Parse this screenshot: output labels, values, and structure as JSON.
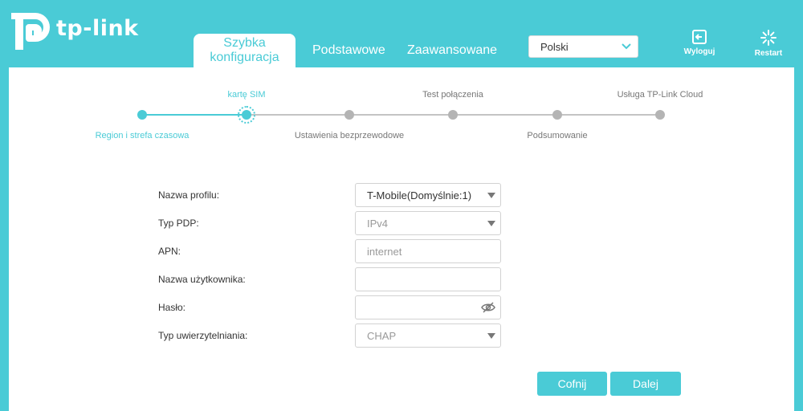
{
  "brand": {
    "name": "tp-link",
    "accent_color": "#4acbd6"
  },
  "nav": {
    "tabs": [
      {
        "label": "Szybka konfiguracja",
        "active": true
      },
      {
        "label": "Podstawowe",
        "active": false
      },
      {
        "label": "Zaawansowane",
        "active": false
      }
    ]
  },
  "language": {
    "selected": "Polski",
    "icon": "chevron-down-icon"
  },
  "header_buttons": {
    "logout": {
      "label": "Wyloguj",
      "icon": "logout-icon"
    },
    "restart": {
      "label": "Restart",
      "icon": "restart-icon"
    }
  },
  "stepper": {
    "current_index": 1,
    "steps": [
      {
        "label": "Region i strefa czasowa"
      },
      {
        "label": "kartę SIM"
      },
      {
        "label": "Ustawienia bezprzewodowe"
      },
      {
        "label": "Test połączenia"
      },
      {
        "label": "Podsumowanie"
      },
      {
        "label": "Usługa TP-Link Cloud"
      }
    ]
  },
  "form": {
    "profile": {
      "label": "Nazwa profilu:",
      "value": "T-Mobile(Domyślnie:1)"
    },
    "pdp_type": {
      "label": "Typ PDP:",
      "value": "IPv4"
    },
    "apn": {
      "label": "APN:",
      "value": "internet"
    },
    "username": {
      "label": "Nazwa użytkownika:",
      "value": ""
    },
    "password": {
      "label": "Hasło:",
      "value": "",
      "icon": "eye-off-icon"
    },
    "auth_type": {
      "label": "Typ uwierzytelniania:",
      "value": "CHAP"
    }
  },
  "actions": {
    "back": "Cofnij",
    "next": "Dalej"
  }
}
